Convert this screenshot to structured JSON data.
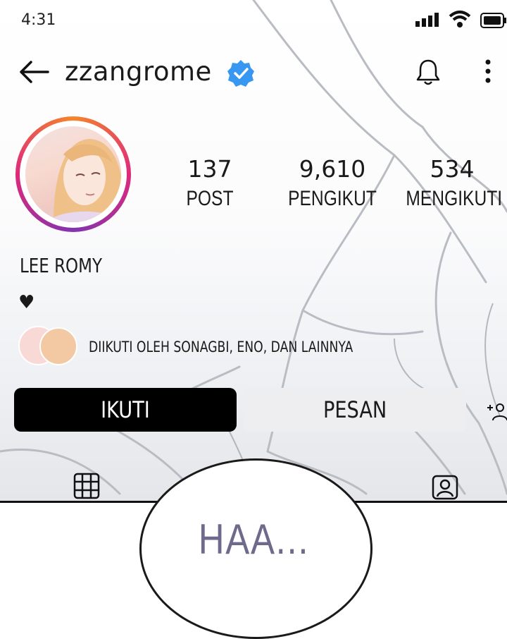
{
  "status_bar": {
    "time": "4:31"
  },
  "profile": {
    "username": "zzangrome",
    "display_name": "LEE ROMY",
    "bio": "♥",
    "stats": [
      {
        "value": "137",
        "label": "POST"
      },
      {
        "value": "9,610",
        "label": "PENGIKUT"
      },
      {
        "value": "534",
        "label": "MENGIKUTI"
      }
    ],
    "followed_by": "DIIKUTI OLEH SONAGBI, ENO, DAN LAINNYA"
  },
  "actions": {
    "follow_label": "IKUTI",
    "message_label": "PESAN"
  },
  "speech_bubble": {
    "text": "HAA..."
  },
  "colors": {
    "accent_verified": "#3897f0",
    "button_primary": "#000000",
    "button_secondary": "#eeeef0"
  },
  "icons": [
    "back-arrow-icon",
    "verified-badge-icon",
    "bell-icon",
    "more-icon",
    "add-person-icon",
    "grid-icon",
    "tagged-icon"
  ]
}
